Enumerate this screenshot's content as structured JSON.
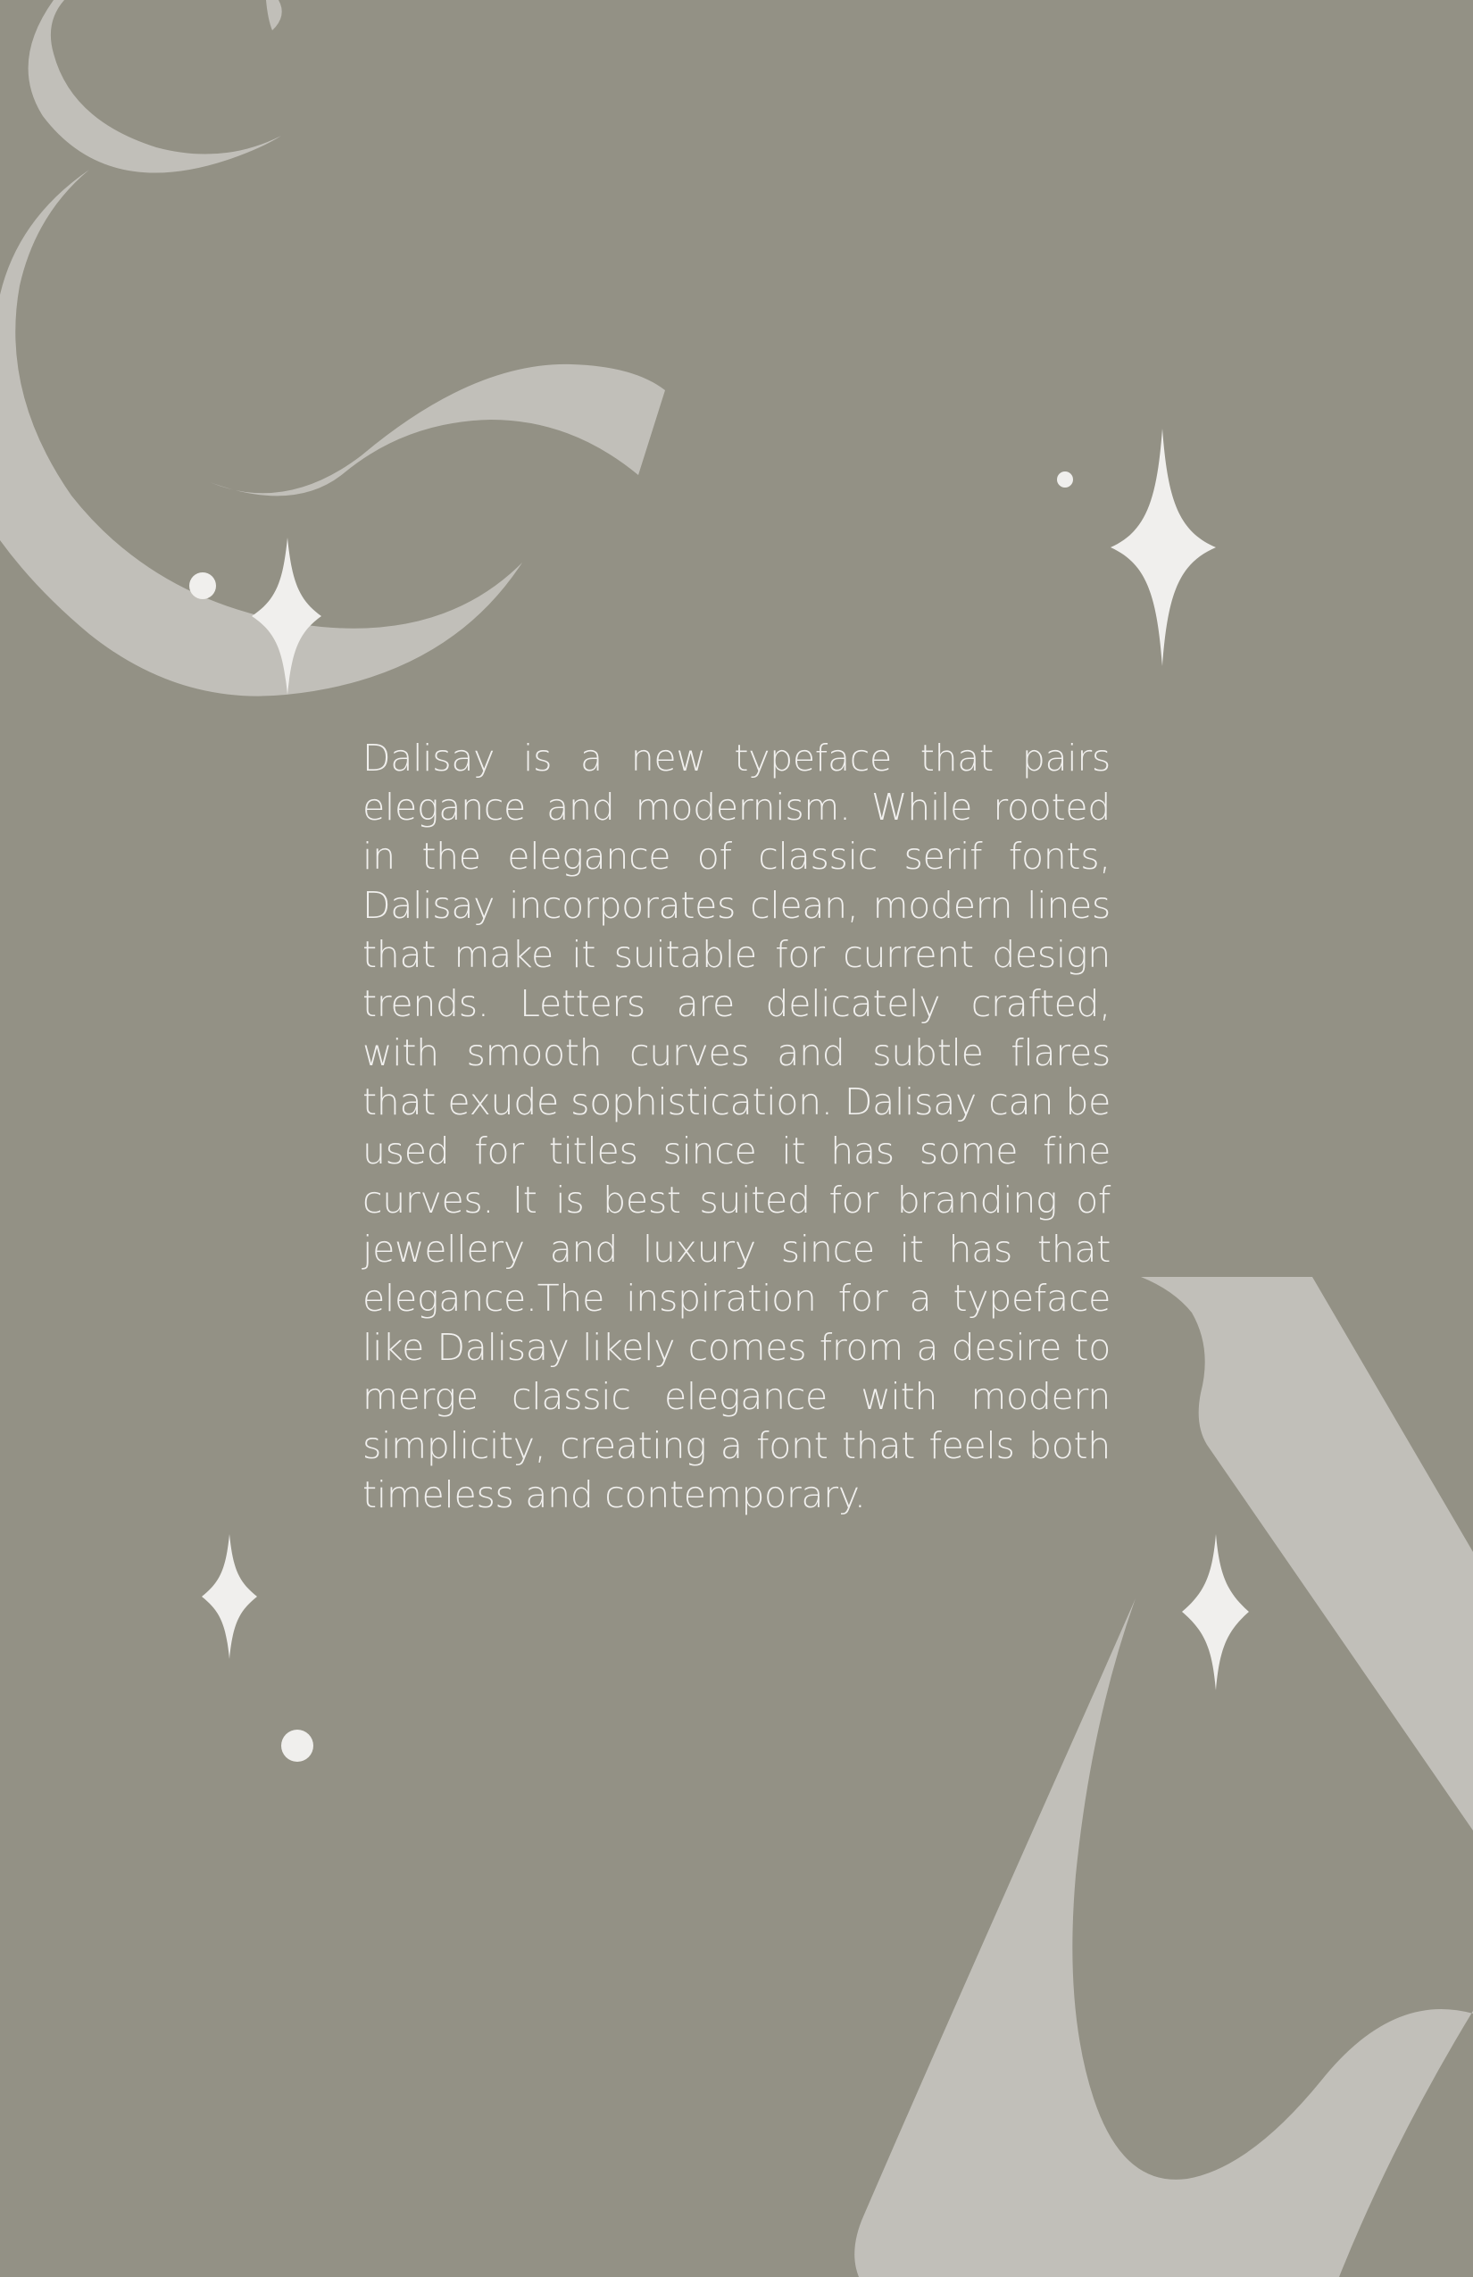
{
  "colors": {
    "background": "#939185",
    "shape": "#c1bfb9",
    "sparkle": "#f0efed",
    "text": "#f1f0ee"
  },
  "document": {
    "body": "Dalisay is a new typeface that pairs elegance and modernism. While rooted in the elegance of classic serif fonts, Dalisay incorporates clean, modern lines that make it suitable for current design trends. Letters are delicately crafted, with smooth curves and subtle flares that exude sophistication. Dalisay can be used for titles since it has some fine curves. It is best suited for branding of jewellery and luxury since it has that elegance.The inspiration for a typeface like Dalisay likely comes from a desire to merge classic elegance with modern simplicity, creating a font that feels both timeless and contemporary."
  },
  "decorations": {
    "shapes": [
      "ampersand-fragment-shape",
      "letter-a-fragment-shape"
    ],
    "icons": [
      "sparkle-icon",
      "dot-icon"
    ]
  }
}
